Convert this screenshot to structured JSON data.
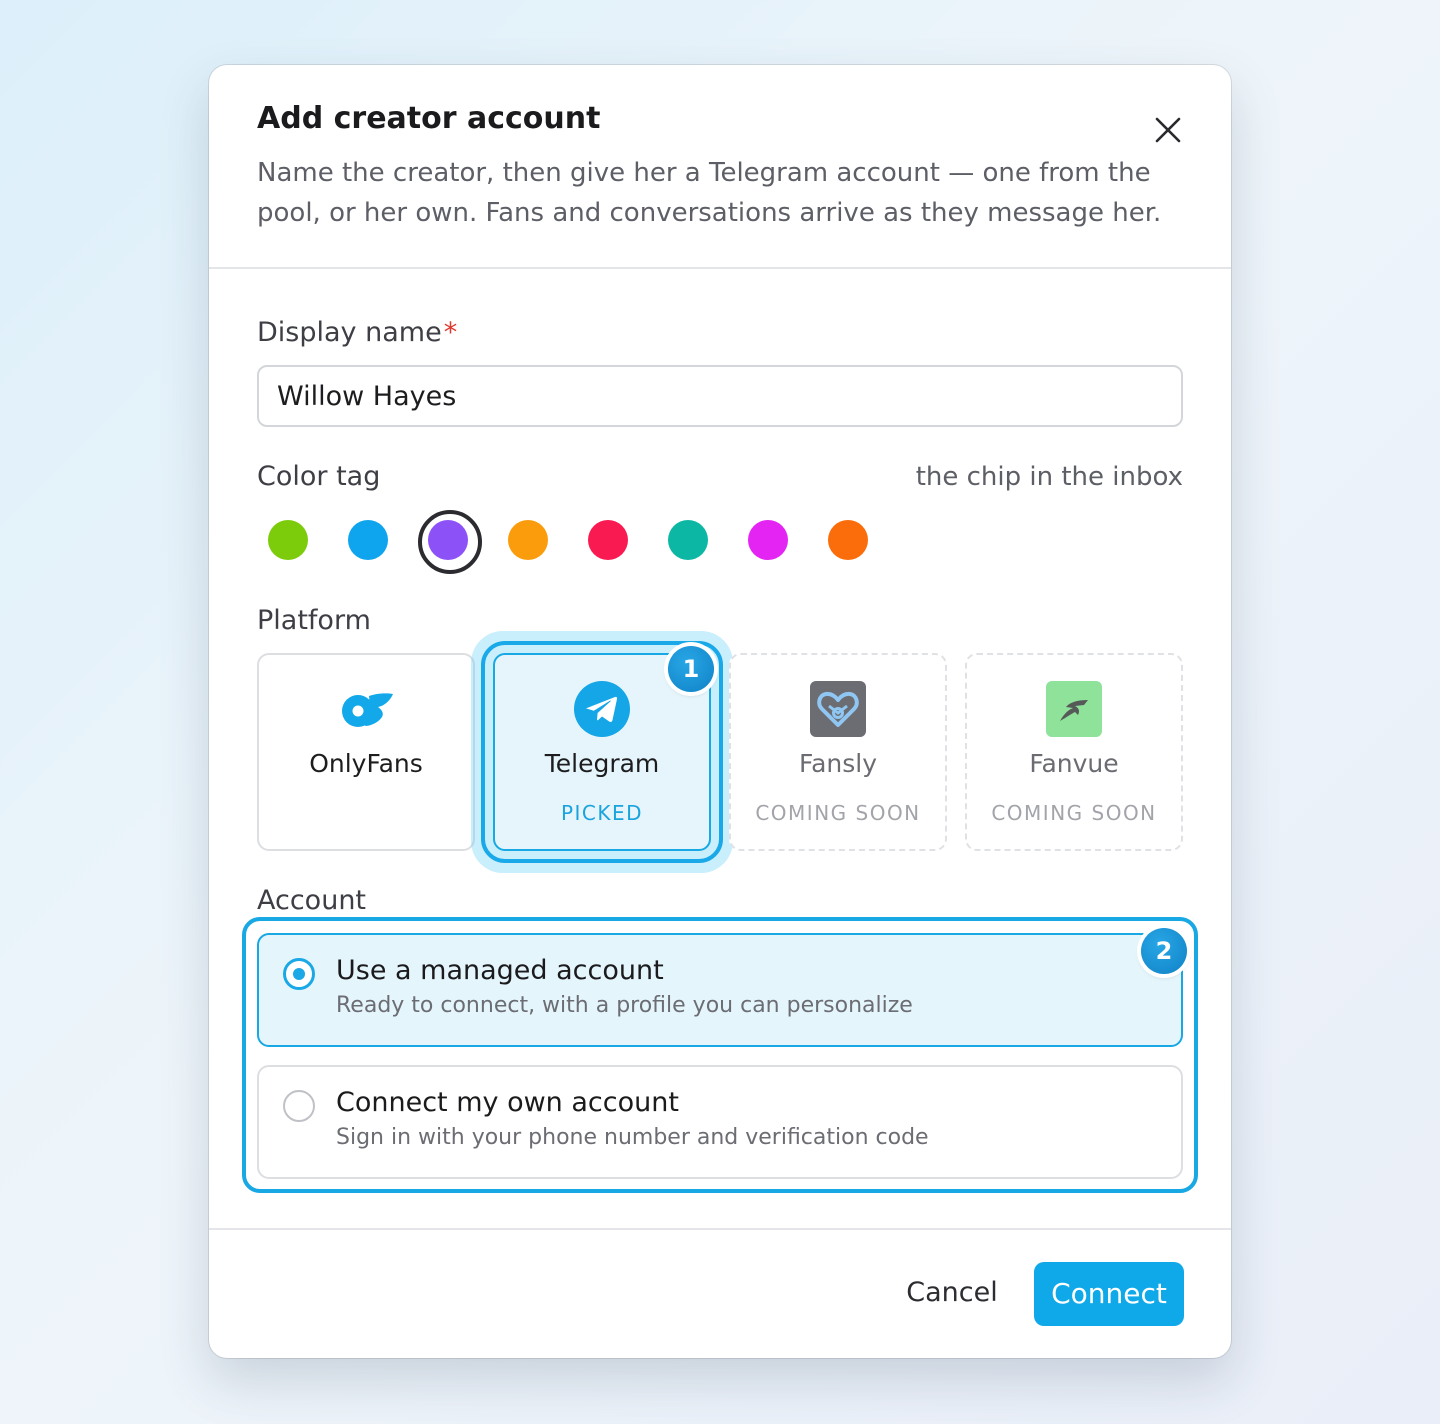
{
  "dialog": {
    "title": "Add creator account",
    "subtitle": "Name the creator, then give her a Telegram account — one from the pool, or her own. Fans and conversations arrive as they message her.",
    "close_icon": "close-icon"
  },
  "display_name": {
    "label": "Display name",
    "required_mark": "*",
    "value": "Willow Hayes"
  },
  "color_tag": {
    "label": "Color tag",
    "hint": "the chip in the inbox",
    "swatches": [
      "#7ccc0c",
      "#0ea4ee",
      "#8d52f7",
      "#fb9c0c",
      "#fa1a52",
      "#0cb8a4",
      "#e424f2",
      "#fb6c0a"
    ],
    "selected_index": 2
  },
  "platform": {
    "label": "Platform",
    "options": [
      {
        "name": "OnlyFans",
        "status": "",
        "icon": "onlyfans-icon"
      },
      {
        "name": "Telegram",
        "status": "PICKED",
        "icon": "telegram-icon"
      },
      {
        "name": "Fansly",
        "status": "COMING SOON",
        "icon": "fansly-icon"
      },
      {
        "name": "Fanvue",
        "status": "COMING SOON",
        "icon": "fanvue-icon"
      }
    ],
    "step_badge": "1"
  },
  "account": {
    "label": "Account",
    "step_badge": "2",
    "options": [
      {
        "title": "Use a managed account",
        "description": "Ready to connect, with a profile you can personalize",
        "selected": true
      },
      {
        "title": "Connect my own account",
        "description": "Sign in with your phone number and verification code",
        "selected": false
      }
    ]
  },
  "footer": {
    "cancel_label": "Cancel",
    "connect_label": "Connect"
  },
  "colors": {
    "accent": "#0fa9ea",
    "required": "#e0392f"
  }
}
